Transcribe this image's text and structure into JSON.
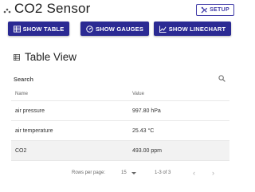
{
  "header": {
    "title": "CO2 Sensor",
    "setup_label": "SETUP"
  },
  "actions": {
    "show_table": "SHOW TABLE",
    "show_gauges": "SHOW GAUGES",
    "show_linechart": "SHOW LINECHART"
  },
  "section": {
    "title": "Table View"
  },
  "table": {
    "search_label": "Search",
    "columns": [
      "Name",
      "Value"
    ],
    "rows": [
      {
        "name": "air pressure",
        "value": "997.80 hPa"
      },
      {
        "name": "air temperature",
        "value": "25.43 °C"
      },
      {
        "name": "CO2",
        "value": "493.00 ppm"
      }
    ],
    "footer": {
      "rows_per_page_label": "Rows per page:",
      "rows_per_page_value": "15",
      "range_text": "1-3 of 3"
    }
  },
  "colors": {
    "primary": "#2b2a93",
    "outline": "#3f3aa7"
  }
}
